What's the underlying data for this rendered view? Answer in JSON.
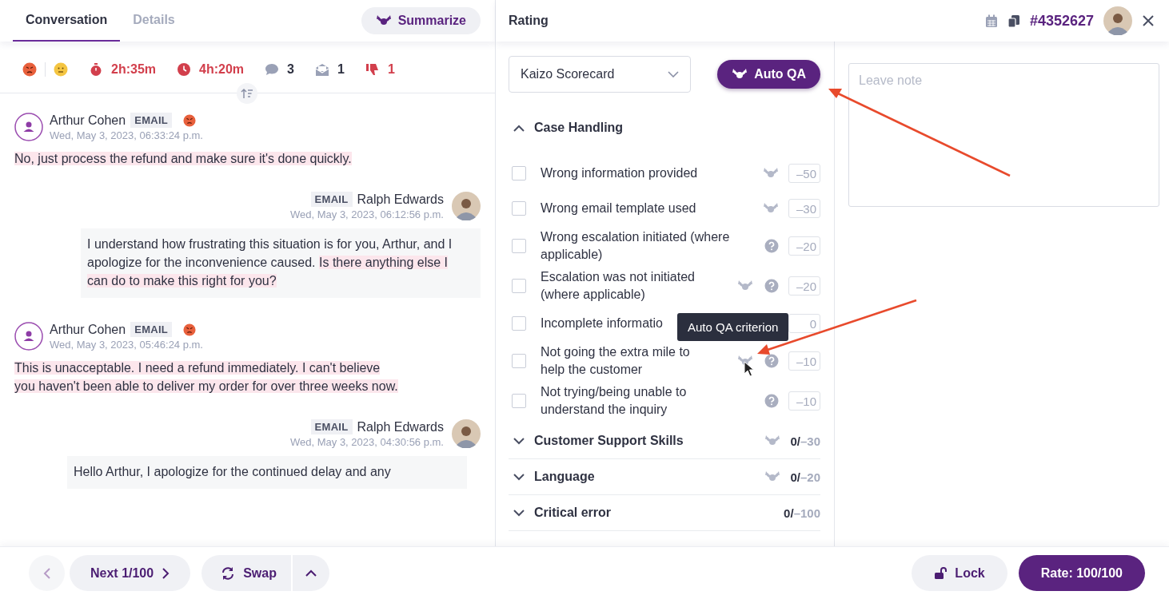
{
  "conversation_panel": {
    "tabs": [
      {
        "label": "Conversation",
        "selected": true
      },
      {
        "label": "Details",
        "selected": false
      }
    ],
    "summarize_button": "Summarize",
    "sentiments": [
      {
        "kind": "angry"
      },
      {
        "kind": "neutral"
      }
    ],
    "metrics": [
      {
        "kind": "timer",
        "value": "2h:35m",
        "alert": true
      },
      {
        "kind": "clock",
        "value": "4h:20m",
        "alert": true
      },
      {
        "kind": "chat",
        "value": "3",
        "alert": false
      },
      {
        "kind": "mail",
        "value": "1",
        "alert": false
      },
      {
        "kind": "thumbs-down",
        "value": "1",
        "alert": true
      }
    ],
    "messages": [
      {
        "kind": "inbound",
        "author": "Arthur Cohen",
        "channel": "EMAIL",
        "angry": true,
        "time": "Wed, May 3, 2023, 06:33:24 p.m.",
        "segments": [
          {
            "text": "No, just process the refund and make sure it's done quickly.",
            "highlighted": true
          }
        ]
      },
      {
        "kind": "outbound",
        "author": "Ralph Edwards",
        "channel": "EMAIL",
        "angry": false,
        "time": "Wed, May 3, 2023, 06:12:56 p.m.",
        "segments": [
          {
            "text": "I understand how frustrating this situation is for you, Arthur, and I apologize for the inconvenience caused. ",
            "highlighted": false
          },
          {
            "text": "Is there anything else I can do to make this right for you?",
            "highlighted": true
          }
        ]
      },
      {
        "kind": "inbound",
        "author": "Arthur Cohen",
        "channel": "EMAIL",
        "angry": true,
        "time": "Wed, May 3, 2023, 05:46:24 p.m.",
        "segments": [
          {
            "text": "This is unacceptable. I need a refund immediately. I can't believe you haven't been able to deliver my order for over three weeks now.",
            "highlighted": true
          }
        ]
      },
      {
        "kind": "outbound",
        "author": "Ralph Edwards",
        "channel": "EMAIL",
        "angry": false,
        "time": "Wed, May 3, 2023, 04:30:56 p.m.",
        "segments": [
          {
            "text": "Hello Arthur, I apologize for the continued delay and any",
            "highlighted": false
          }
        ]
      }
    ]
  },
  "rating_panel": {
    "title": "Rating",
    "ticket": "#4352627",
    "scorecard": "Kaizo Scorecard",
    "auto_qa_button": "Auto QA",
    "sections": [
      {
        "title": "Case Handling",
        "expanded": true,
        "auto_qa": false,
        "criteria": [
          {
            "label": "Wrong information provided",
            "checked": false,
            "auto_qa": true,
            "help": false,
            "score": "–50"
          },
          {
            "label": "Wrong email template used",
            "checked": false,
            "auto_qa": true,
            "help": false,
            "score": "–30"
          },
          {
            "label": "Wrong escalation initiated (where applicable)",
            "checked": false,
            "auto_qa": false,
            "help": true,
            "score": "–20"
          },
          {
            "label": "Escalation was not initiated (where applicable)",
            "checked": false,
            "auto_qa": true,
            "help": true,
            "score": "–20"
          },
          {
            "label": "Incomplete informatio",
            "checked": false,
            "auto_qa": false,
            "help": false,
            "score": "0"
          },
          {
            "label": "Not going the extra mile to help the customer",
            "checked": false,
            "auto_qa": true,
            "help": true,
            "score": "–10"
          },
          {
            "label": "Not trying/being unable to understand the inquiry",
            "checked": false,
            "auto_qa": false,
            "help": true,
            "score": "–10"
          }
        ]
      },
      {
        "title": "Customer Support Skills",
        "expanded": false,
        "auto_qa": true,
        "score": "0/",
        "max": "–30"
      },
      {
        "title": "Language",
        "expanded": false,
        "auto_qa": true,
        "score": "0/",
        "max": "–20"
      },
      {
        "title": "Critical error",
        "expanded": false,
        "auto_qa": false,
        "score": "0/",
        "max": "–100"
      }
    ],
    "tooltip": "Auto QA criterion",
    "note": {
      "placeholder": "Leave note"
    }
  },
  "footer": {
    "next_button": "Next 1/100",
    "swap_button": "Swap",
    "lock_button": "Lock",
    "rate_button": "Rate: 100/100"
  }
}
